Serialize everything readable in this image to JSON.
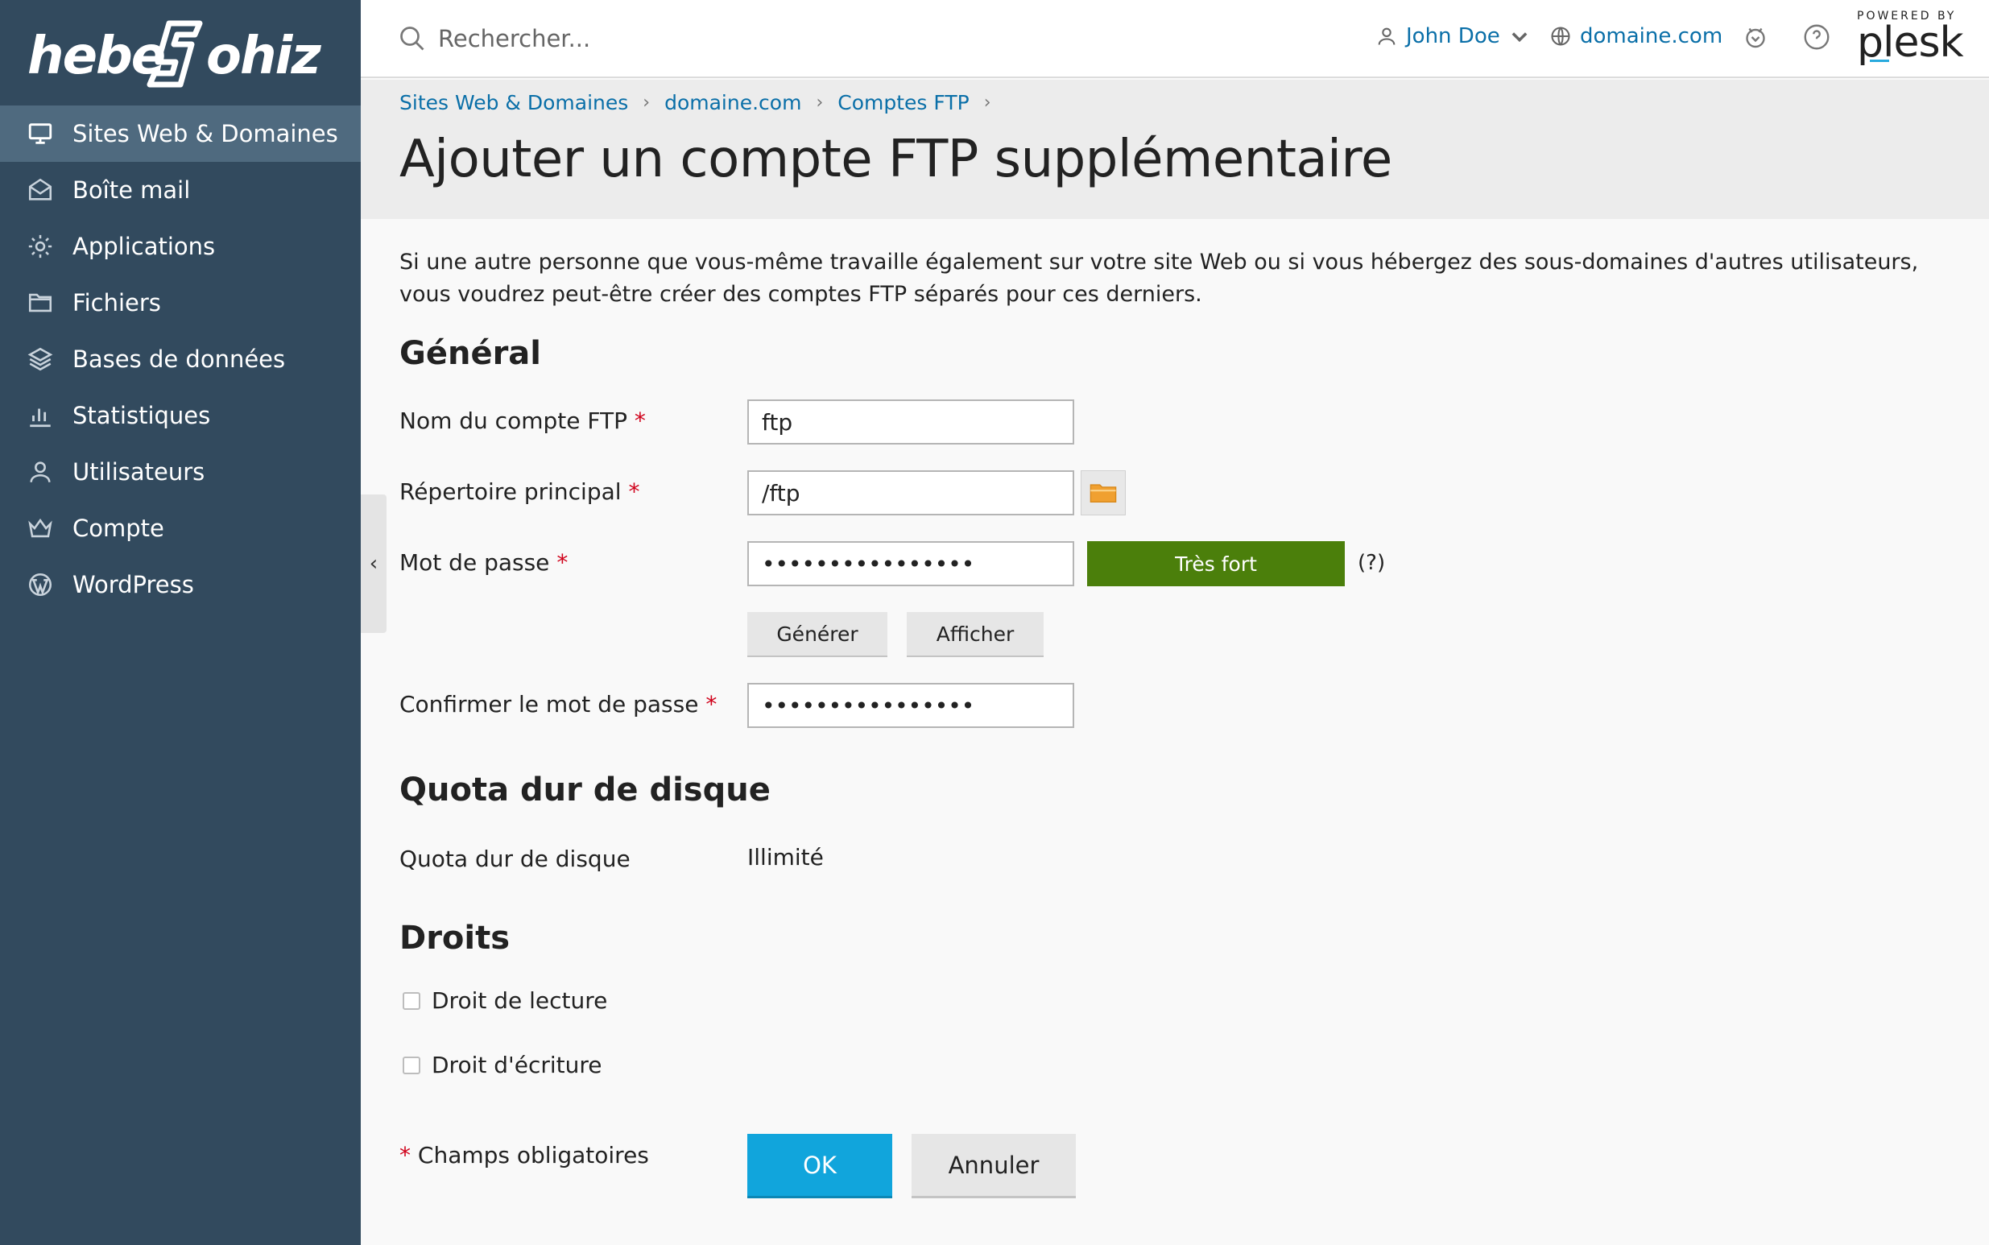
{
  "brand": {
    "logo_text": "hebergeurs johiz"
  },
  "sidebar": {
    "items": [
      {
        "label": "Sites Web & Domaines",
        "icon": "monitor-icon",
        "active": true
      },
      {
        "label": "Boîte mail",
        "icon": "mail-icon"
      },
      {
        "label": "Applications",
        "icon": "gear-icon"
      },
      {
        "label": "Fichiers",
        "icon": "folder-icon"
      },
      {
        "label": "Bases de données",
        "icon": "database-icon"
      },
      {
        "label": "Statistiques",
        "icon": "chart-icon"
      },
      {
        "label": "Utilisateurs",
        "icon": "user-icon"
      },
      {
        "label": "Compte",
        "icon": "crown-icon"
      },
      {
        "label": "WordPress",
        "icon": "wordpress-icon"
      }
    ],
    "collapse_glyph": "‹"
  },
  "header": {
    "search_placeholder": "Rechercher...",
    "user_name": "John Doe",
    "domain": "domaine.com",
    "powered_by": "POWERED BY",
    "plesk": "plesk"
  },
  "breadcrumb": [
    "Sites Web & Domaines",
    "domaine.com",
    "Comptes FTP"
  ],
  "page": {
    "title": "Ajouter un compte FTP supplémentaire",
    "intro": "Si une autre personne que vous-même travaille également sur votre site Web ou si vous hébergez des sous-domaines d'autres utilisateurs, vous voudrez peut-être créer des comptes FTP séparés pour ces derniers."
  },
  "general": {
    "title": "Général",
    "ftp_name_label": "Nom du compte FTP",
    "ftp_name_value": "ftp",
    "home_dir_label": "Répertoire principal",
    "home_dir_value": "/ftp",
    "password_label": "Mot de passe",
    "password_value": "••••••••••••••••",
    "strength": "Très fort",
    "help": "(?)",
    "generate": "Générer",
    "show": "Afficher",
    "confirm_label": "Confirmer le mot de passe",
    "confirm_value": "••••••••••••••••",
    "required_mark": "*"
  },
  "quota": {
    "title": "Quota dur de disque",
    "label": "Quota dur de disque",
    "value": "Illimité"
  },
  "rights": {
    "title": "Droits",
    "read": "Droit de lecture",
    "write": "Droit d'écriture"
  },
  "footer": {
    "required_note": "Champs obligatoires",
    "ok": "OK",
    "cancel": "Annuler"
  },
  "colors": {
    "sidebar_bg": "#324a5e",
    "sidebar_active": "#4f6a7f",
    "link": "#0a6fa8",
    "strength_bg": "#4b7f0b",
    "ok_bg": "#11a5dc",
    "required": "#d0021b"
  }
}
